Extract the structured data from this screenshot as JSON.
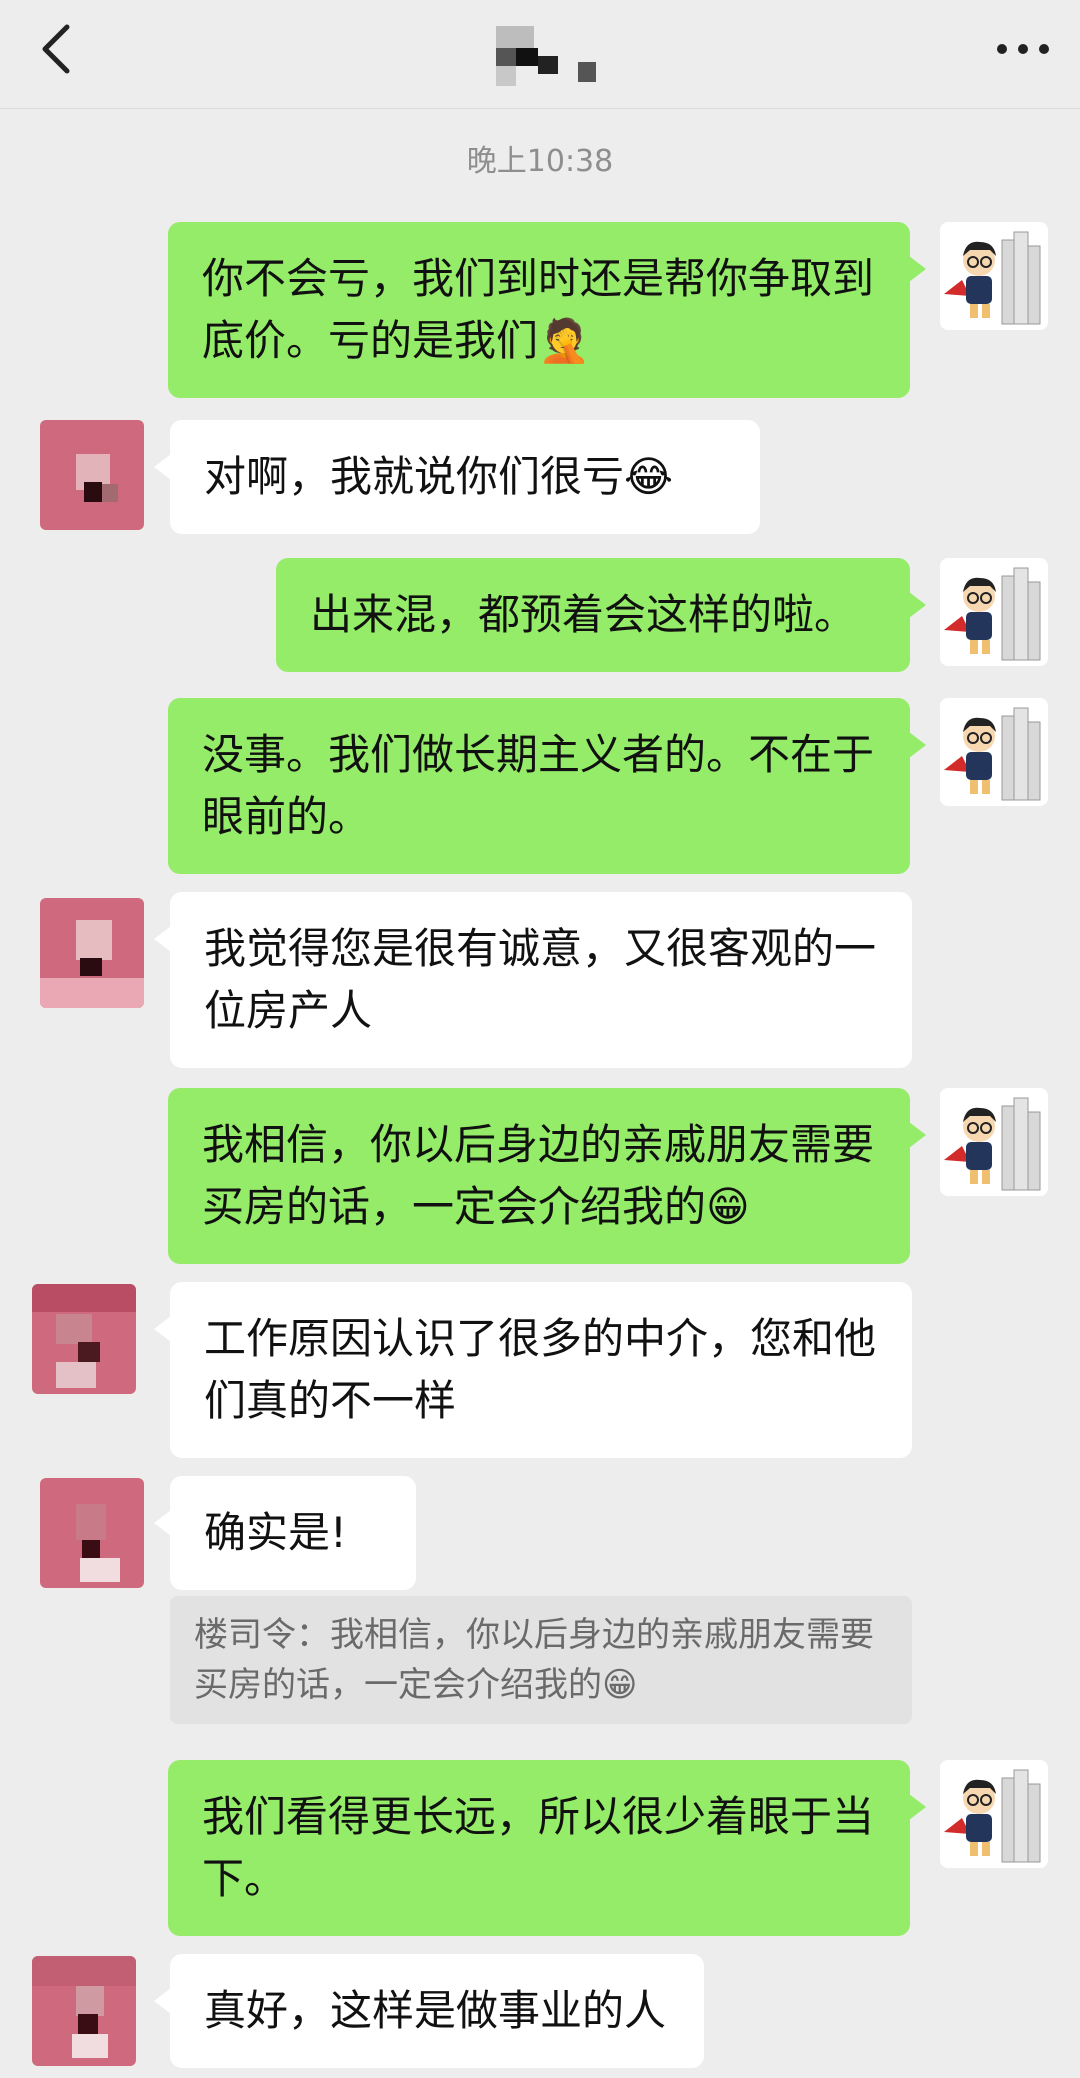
{
  "header": {
    "back_icon": "chevron-left-icon",
    "more_icon": "more-dots-icon"
  },
  "timestamp": "晚上10:38",
  "messages": [
    {
      "from": "me",
      "text": "你不会亏，我们到时还是帮你争取到底价。亏的是我们🤦"
    },
    {
      "from": "them",
      "text": "对啊，我就说你们很亏😂"
    },
    {
      "from": "me",
      "text": "出来混，都预着会这样的啦。"
    },
    {
      "from": "me",
      "text": "没事。我们做长期主义者的。不在于眼前的。"
    },
    {
      "from": "them",
      "text": "我觉得您是很有诚意，又很客观的一位房产人"
    },
    {
      "from": "me",
      "text": "我相信，你以后身边的亲戚朋友需要买房的话，一定会介绍我的😁"
    },
    {
      "from": "them",
      "text": "工作原因认识了很多的中介，您和他们真的不一样"
    },
    {
      "from": "them",
      "text": "确实是!",
      "quote": "楼司令：我相信，你以后身边的亲戚朋友需要买房的话，一定会介绍我的😁"
    },
    {
      "from": "me",
      "text": "我们看得更长远，所以很少着眼于当下。"
    },
    {
      "from": "them",
      "text": "真好，这样是做事业的人"
    }
  ],
  "colors": {
    "background": "#ededed",
    "my_bubble": "#95ec69",
    "their_bubble": "#ffffff"
  }
}
